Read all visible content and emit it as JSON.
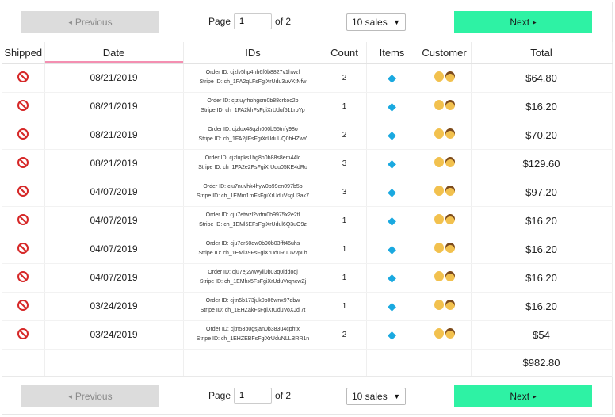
{
  "pagination": {
    "previous_label": "Previous",
    "next_label": "Next",
    "page_label": "Page",
    "page_value": "1",
    "of_label": "of 2",
    "per_page": "10 sales"
  },
  "columns": [
    "Shipped",
    "Date",
    "IDs",
    "Count",
    "Items",
    "Customer",
    "Total"
  ],
  "rows": [
    {
      "date": "08/21/2019",
      "order": "Order ID: cjzlv5hp4hh6f0b8827v1hwzf",
      "stripe": "Stripe ID: ch_1FA2qLFsFgiXrUdu3uVKtNfw",
      "count": "2",
      "total": "$64.80"
    },
    {
      "date": "08/21/2019",
      "order": "Order ID: cjzluyfhohgsm0b88crkoc2b",
      "stripe": "Stripe ID: ch_1FA2khFsFgiXrUduf51LrpYp",
      "count": "1",
      "total": "$16.20"
    },
    {
      "date": "08/21/2019",
      "order": "Order ID: cjzlux48qzh000b55tnfy98o",
      "stripe": "Stripe ID: ch_1FA2jIFsFgiXrUduUQ0hHZwY",
      "count": "2",
      "total": "$70.20"
    },
    {
      "date": "08/21/2019",
      "order": "Order ID: cjzlupks1hg8h0b88s8em44lc",
      "stripe": "Stripe ID: ch_1FA2e2FsFgiXrUdu05KE4dRu",
      "count": "3",
      "total": "$129.60"
    },
    {
      "date": "04/07/2019",
      "order": "Order ID: cju7nuvhk4hyw0b99en097b5p",
      "stripe": "Stripe ID: ch_1EMm1mFsFgiXrUduVsgU3ak7",
      "count": "3",
      "total": "$97.20"
    },
    {
      "date": "04/07/2019",
      "order": "Order ID: cju7etwzl2vdm0b9975x2e2tl",
      "stripe": "Stripe ID: ch_1EMl5EFsFgiXrUdul6Q3uO9z",
      "count": "1",
      "total": "$16.20"
    },
    {
      "date": "04/07/2019",
      "order": "Order ID: cju7er50qw0b90b03fft46uhs",
      "stripe": "Stripe ID: ch_1EMl39FsFgiXrUduRuUVvpLh",
      "count": "1",
      "total": "$16.20"
    },
    {
      "date": "04/07/2019",
      "order": "Order ID: cju7ej2vwvyll0b03q0lddodj",
      "stripe": "Stripe ID: ch_1EMhx5FsFgiXrUduVrqhcwZj",
      "count": "1",
      "total": "$16.20"
    },
    {
      "date": "03/24/2019",
      "order": "Order ID: cjtn5b173juk0b06wnx97qbw",
      "stripe": "Stripe ID: ch_1EHZakFsFgiXrUduVoXJdl7t",
      "count": "1",
      "total": "$16.20"
    },
    {
      "date": "03/24/2019",
      "order": "Order ID: cjtn53b0gsjan0b383u4cphtx",
      "stripe": "Stripe ID: ch_1EHZEBFsFgiXrUduNLLBRR1n",
      "count": "2",
      "total": "$54"
    }
  ],
  "grand_total": "$982.80",
  "icons": {
    "shipped": "no-entry-icon",
    "items": "gem-icon",
    "customer": "people-icon"
  },
  "colors": {
    "next": "#2ef2a4",
    "previous": "#dcdcdc",
    "sort_indicator": "#f48fb1"
  }
}
